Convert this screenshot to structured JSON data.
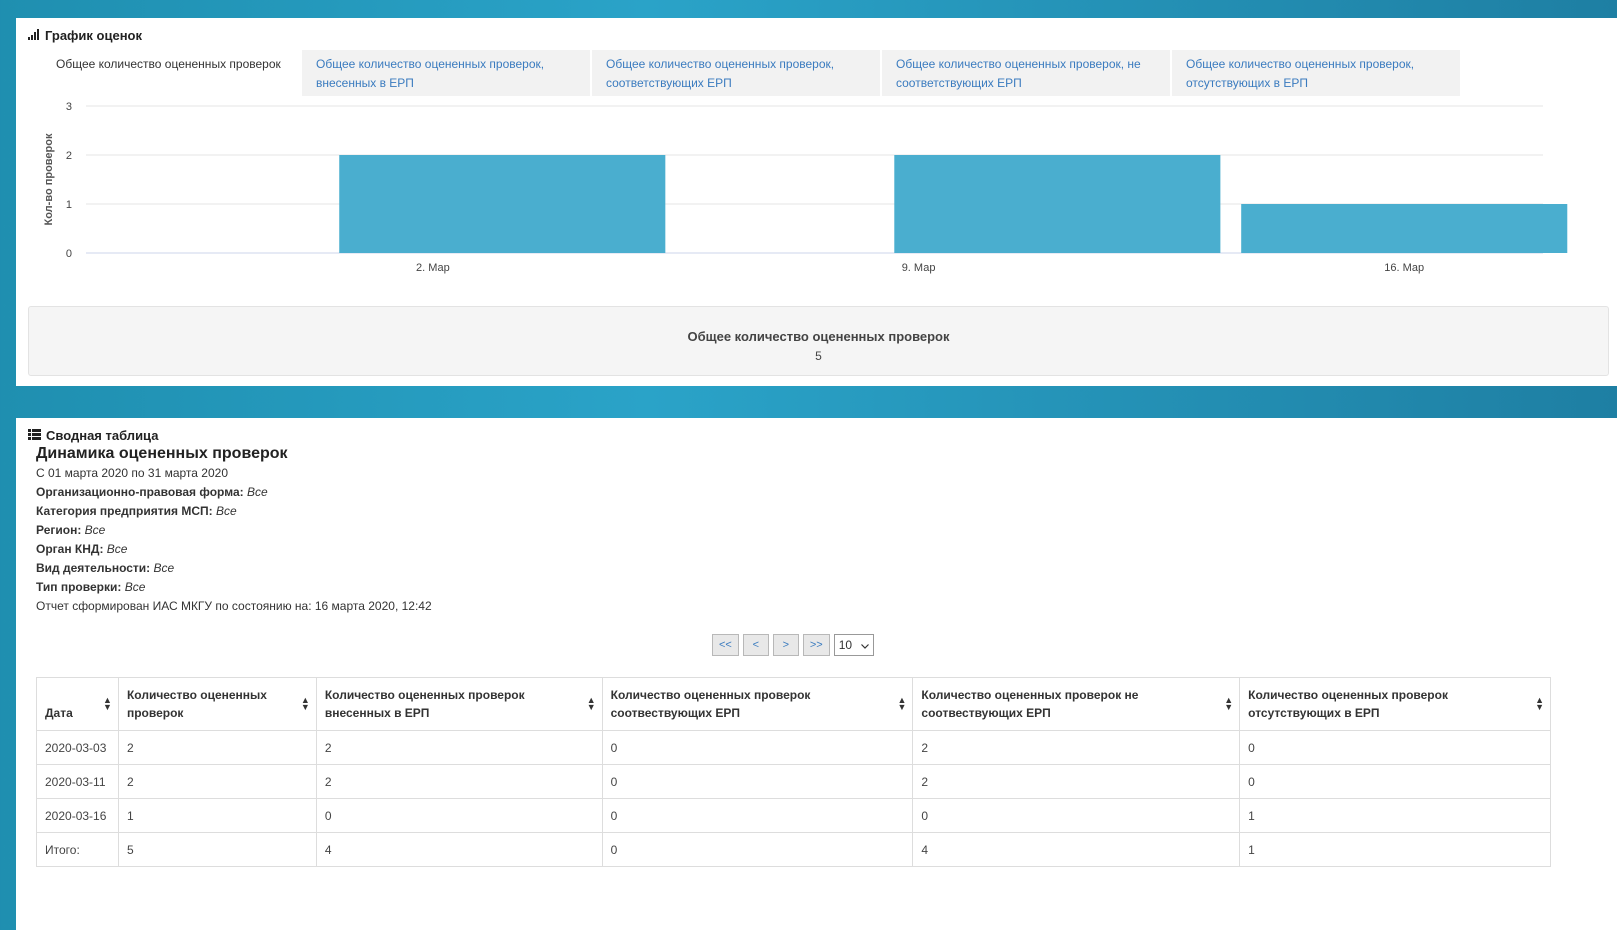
{
  "chart_panel": {
    "title": "График оценок",
    "tabs": [
      {
        "label": "Общее количество оцененных проверок",
        "active": true
      },
      {
        "label": "Общее количество оцененных проверок, внесенных в ЕРП",
        "active": false
      },
      {
        "label": "Общее количество оцененных проверок, соответствующих ЕРП",
        "active": false
      },
      {
        "label": "Общее количество оцененных проверок, не соответствующих ЕРП",
        "active": false
      },
      {
        "label": "Общее количество оцененных проверок, отсутствующих в ЕРП",
        "active": false
      }
    ],
    "summary": {
      "title": "Общее количество оцененных проверок",
      "value": "5"
    }
  },
  "chart_data": {
    "type": "bar",
    "ylabel": "Кол-во проверок",
    "xlabel": "",
    "ylim": [
      0,
      3
    ],
    "yticks": [
      0,
      1,
      2,
      3
    ],
    "x_ticks": [
      {
        "label": "2. Мар",
        "date": "2020-03-02"
      },
      {
        "label": "9. Мар",
        "date": "2020-03-09"
      },
      {
        "label": "16. Мар",
        "date": "2020-03-16"
      }
    ],
    "xlim": [
      "2020-02-26",
      "2020-03-18"
    ],
    "bars": [
      {
        "date": "2020-03-03",
        "value": 2
      },
      {
        "date": "2020-03-11",
        "value": 2
      },
      {
        "date": "2020-03-16",
        "value": 1
      }
    ],
    "bar_color": "#4aaecf",
    "grid": true
  },
  "table_panel": {
    "title": "Сводная таблица",
    "report_title": "Динамика оцененных проверок",
    "period": "С 01 марта 2020 по 31 марта 2020",
    "filters": [
      {
        "label": "Организационно-правовая форма:",
        "value": "Все"
      },
      {
        "label": "Категория предприятия МСП:",
        "value": "Все"
      },
      {
        "label": "Регион:",
        "value": "Все"
      },
      {
        "label": "Орган КНД:",
        "value": "Все"
      },
      {
        "label": "Вид деятельности:",
        "value": "Все"
      },
      {
        "label": "Тип проверки:",
        "value": "Все"
      }
    ],
    "generated": "Отчет сформирован ИАС МКГУ по состоянию на: 16 марта 2020, 12:42",
    "pager": {
      "first": "<<",
      "prev": "<",
      "next": ">",
      "last": ">>",
      "page_size": "10"
    },
    "columns": [
      "Дата",
      "Количество оцененных проверок",
      "Количество оцененных проверок внесенных в ЕРП",
      "Количество оцененных проверок соотвествующих ЕРП",
      "Количество оцененных проверок не соотвествующих ЕРП",
      "Количество оцененных проверок отсутствующих в ЕРП"
    ],
    "rows": [
      [
        "2020-03-03",
        "2",
        "2",
        "0",
        "2",
        "0"
      ],
      [
        "2020-03-11",
        "2",
        "2",
        "0",
        "2",
        "0"
      ],
      [
        "2020-03-16",
        "1",
        "0",
        "0",
        "0",
        "1"
      ],
      [
        "Итого:",
        "5",
        "4",
        "0",
        "4",
        "1"
      ]
    ]
  }
}
